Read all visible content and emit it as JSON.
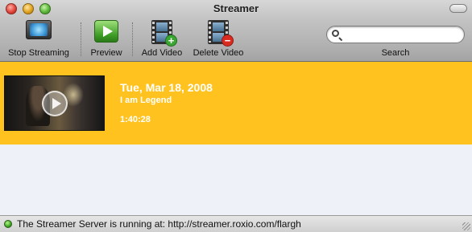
{
  "window": {
    "title": "Streamer"
  },
  "toolbar": {
    "stop_streaming": {
      "label": "Stop Streaming",
      "icon": "monitor-icon"
    },
    "preview": {
      "label": "Preview",
      "icon": "play-icon"
    },
    "add_video": {
      "label": "Add Video",
      "icon": "film-add-icon"
    },
    "delete_video": {
      "label": "Delete Video",
      "icon": "film-delete-icon"
    }
  },
  "search": {
    "label": "Search",
    "value": "",
    "placeholder": ""
  },
  "videos": [
    {
      "date": "Tue, Mar 18, 2008",
      "name": "I am Legend",
      "duration": "1:40:28",
      "selected": true
    }
  ],
  "status": {
    "text": "The Streamer Server is running at: http://streamer.roxio.com/flargh",
    "indicator": "running"
  },
  "colors": {
    "selection": "#ffc21f",
    "list_background": "#eef2f8",
    "add_badge": "#3aa632",
    "delete_badge": "#d92b20",
    "status_running": "#3aa61e"
  }
}
